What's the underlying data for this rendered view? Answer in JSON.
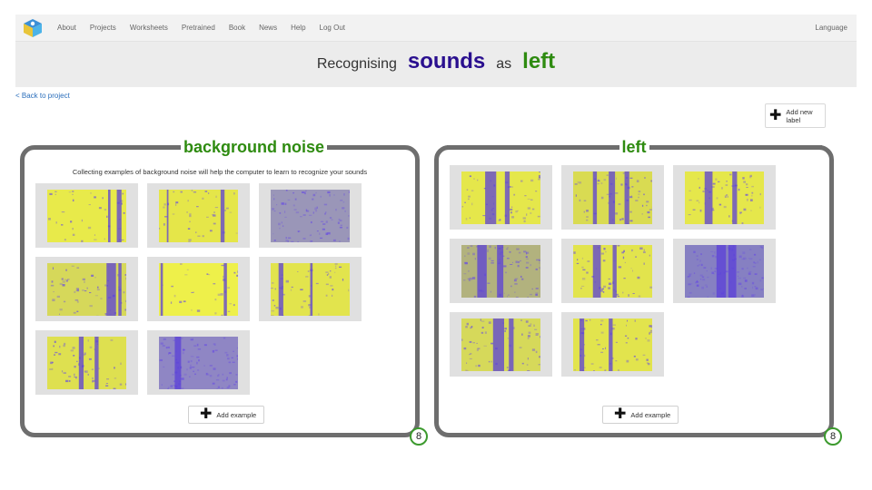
{
  "nav": {
    "links": [
      "About",
      "Projects",
      "Worksheets",
      "Pretrained",
      "Book",
      "News",
      "Help",
      "Log Out"
    ],
    "language": "Language",
    "logo_icon": "ml4k-cube-logo"
  },
  "title": {
    "prefix": "Recognising",
    "type": "sounds",
    "middle": "as",
    "label": "left",
    "type_color": "#2a0f8f",
    "label_color": "#2e8b10"
  },
  "back_link": "< Back to project",
  "add_label": {
    "text": "Add new\nlabel",
    "icon": "plus-icon"
  },
  "cards": [
    {
      "name": "background noise",
      "hint": "Collecting examples of background noise will help the computer to learn to recognize your sounds",
      "add_example": "Add example",
      "count": "8",
      "examples": [
        {
          "bg": "#e8ea4a",
          "streaks": [
            [
              88,
              6
            ],
            [
              77,
              3
            ]
          ],
          "density": 0.15
        },
        {
          "bg": "#e5e649",
          "streaks": [
            [
              78,
              5
            ],
            [
              10,
              2
            ]
          ],
          "density": 0.18
        },
        {
          "bg": "#9a96b8",
          "streaks": [],
          "density": 0.6
        },
        {
          "bg": "#d6d85a",
          "streaks": [
            [
              75,
              12
            ],
            [
              90,
              4
            ]
          ],
          "density": 0.35
        },
        {
          "bg": "#eef04a",
          "streaks": [
            [
              2,
              3
            ],
            [
              82,
              4
            ]
          ],
          "density": 0.1
        },
        {
          "bg": "#e2e44d",
          "streaks": [
            [
              10,
              6
            ],
            [
              50,
              3
            ]
          ],
          "density": 0.25
        },
        {
          "bg": "#dee050",
          "streaks": [
            [
              40,
              6
            ],
            [
              60,
              5
            ]
          ],
          "density": 0.3
        },
        {
          "bg": "#8f86c4",
          "streaks": [
            [
              20,
              8
            ]
          ],
          "density": 0.65
        }
      ]
    },
    {
      "name": "left",
      "hint": "",
      "add_example": "Add example",
      "count": "8",
      "examples": [
        {
          "bg": "#e5e74b",
          "streaks": [
            [
              30,
              14
            ],
            [
              55,
              6
            ]
          ],
          "density": 0.3
        },
        {
          "bg": "#d9db52",
          "streaks": [
            [
              45,
              8
            ],
            [
              65,
              6
            ],
            [
              25,
              5
            ]
          ],
          "density": 0.35
        },
        {
          "bg": "#e5e74b",
          "streaks": [
            [
              25,
              10
            ],
            [
              60,
              6
            ]
          ],
          "density": 0.3
        },
        {
          "bg": "#b2b27e",
          "streaks": [
            [
              20,
              12
            ],
            [
              45,
              8
            ]
          ],
          "density": 0.55
        },
        {
          "bg": "#e2e44d",
          "streaks": [
            [
              25,
              10
            ],
            [
              50,
              5
            ]
          ],
          "density": 0.3
        },
        {
          "bg": "#8680c2",
          "streaks": [
            [
              40,
              12
            ],
            [
              55,
              10
            ]
          ],
          "density": 0.7
        },
        {
          "bg": "#d6d95a",
          "streaks": [
            [
              40,
              14
            ],
            [
              60,
              6
            ]
          ],
          "density": 0.35
        },
        {
          "bg": "#e2e44d",
          "streaks": [
            [
              8,
              6
            ],
            [
              45,
              5
            ]
          ],
          "density": 0.3
        }
      ]
    }
  ]
}
